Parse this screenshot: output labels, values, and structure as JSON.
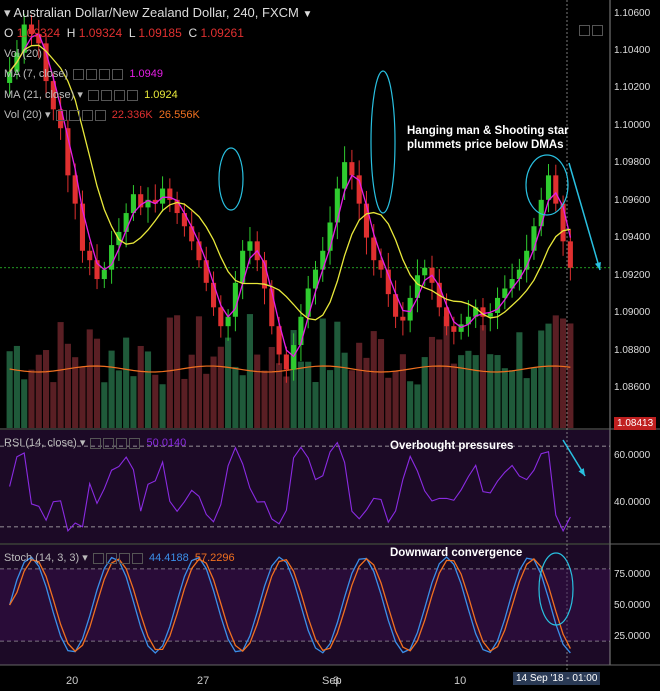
{
  "header": {
    "title": "Australian Dollar/New Zealand Dollar, 240, FXCM",
    "ohlc": {
      "o_label": "O",
      "o_value": "1.09324",
      "h_label": "H",
      "h_value": "1.09324",
      "l_label": "L",
      "l_value": "1.09185",
      "c_label": "C",
      "c_value": "1.09261"
    }
  },
  "indicators": {
    "vol_top": "Vol (20)",
    "ma7_label": "MA (7, close)",
    "ma7_value": "1.0949",
    "ma21_label": "MA (21, close)",
    "ma21_value": "1.0924",
    "vol_label": "Vol (20)",
    "vol_value1": "22.336K",
    "vol_value2": "26.556K",
    "rsi_label": "RSI (14, close)",
    "rsi_value": "50.0140",
    "stoch_label": "Stoch (14, 3, 3)",
    "stoch_k": "44.4188",
    "stoch_d": "57.2296"
  },
  "annotations": {
    "main_line1": "Hanging man & Shooting star",
    "main_line2": "plummets price below DMAs",
    "rsi_note": "Overbought pressures",
    "stoch_note": "Downward convergence"
  },
  "price_axis": {
    "ticks": [
      "1.10600",
      "1.10400",
      "1.10200",
      "1.10000",
      "1.09800",
      "1.09600",
      "1.09400",
      "1.09200",
      "1.09000",
      "1.08800",
      "1.08600"
    ],
    "last_tag": "1.08413"
  },
  "rsi_axis": {
    "ticks": [
      "60.0000",
      "40.0000"
    ]
  },
  "stoch_axis": {
    "ticks": [
      "75.0000",
      "50.0000",
      "25.0000"
    ]
  },
  "x_axis": {
    "ticks": [
      "20",
      "27",
      "Sep",
      "3",
      "10"
    ],
    "cursor_label": "14 Sep '18 - 01:00"
  },
  "colors": {
    "bull": "#2fcc2f",
    "bear": "#e03030",
    "ma7": "#e61ee6",
    "ma21": "#e8e83a",
    "rsi": "#8a2be2",
    "stoch_k": "#3b8fe8",
    "stoch_d": "#f07020",
    "annotation": "#29c0e0"
  },
  "chart_data": {
    "type": "candlestick",
    "instrument": "Australian Dollar/New Zealand Dollar, 240, FXCM",
    "price_range": [
      1.0841,
      1.1068
    ],
    "close": [
      1.103,
      1.104,
      1.1055,
      1.105,
      1.1045,
      1.1025,
      1.101,
      1.1,
      1.0975,
      1.096,
      1.0935,
      1.093,
      1.092,
      1.0925,
      1.0938,
      1.0945,
      1.0955,
      1.0965,
      1.0958,
      1.0962,
      1.096,
      1.0968,
      1.0962,
      1.0955,
      1.0948,
      1.094,
      1.093,
      1.0918,
      1.0905,
      1.0895,
      1.09,
      1.0918,
      1.0935,
      1.094,
      1.093,
      1.0915,
      1.0895,
      1.088,
      1.0872,
      1.0885,
      1.09,
      1.0915,
      1.0925,
      1.0935,
      1.095,
      1.0968,
      1.0982,
      1.0975,
      1.096,
      1.0942,
      1.093,
      1.0925,
      1.0912,
      1.09,
      1.0898,
      1.091,
      1.0922,
      1.0926,
      1.0918,
      1.0905,
      1.0895,
      1.0892,
      1.0896,
      1.09,
      1.0905,
      1.09,
      1.0902,
      1.091,
      1.0915,
      1.092,
      1.0925,
      1.0935,
      1.0948,
      1.0962,
      1.0975,
      1.096,
      1.094,
      1.0926
    ],
    "rsi_levels": [
      70,
      30
    ],
    "rsi_range": [
      22,
      78
    ],
    "stoch_levels": [
      80,
      20
    ],
    "stoch_range": [
      0,
      100
    ]
  }
}
